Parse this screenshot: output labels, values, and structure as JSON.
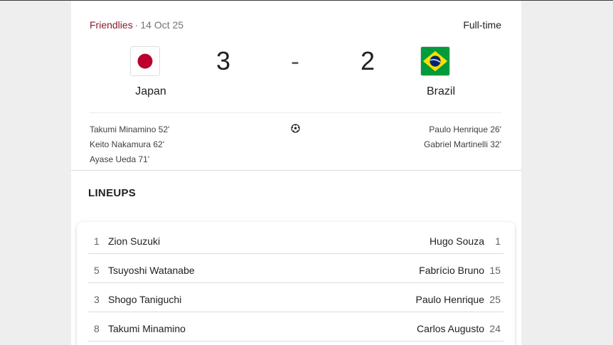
{
  "match": {
    "competition": "Friendlies",
    "separator": "·",
    "date": "14 Oct 25",
    "status": "Full-time",
    "home": {
      "name": "Japan",
      "score": "3",
      "flag_icon": "japan-flag-icon"
    },
    "away": {
      "name": "Brazil",
      "score": "2",
      "flag_icon": "brazil-flag-icon"
    },
    "dash": "-",
    "home_scorers": [
      "Takumi Minamino 52'",
      "Keito Nakamura 62'",
      "Ayase Ueda 71'"
    ],
    "away_scorers": [
      "Paulo Henrique 26'",
      "Gabriel Martinelli 32'"
    ]
  },
  "lineups": {
    "title": "LINEUPS",
    "rows": [
      {
        "home_num": "1",
        "home_name": "Zion Suzuki",
        "away_name": "Hugo Souza",
        "away_num": "1"
      },
      {
        "home_num": "5",
        "home_name": "Tsuyoshi Watanabe",
        "away_name": "Fabrício Bruno",
        "away_num": "15"
      },
      {
        "home_num": "3",
        "home_name": "Shogo Taniguchi",
        "away_name": "Paulo Henrique",
        "away_num": "25"
      },
      {
        "home_num": "8",
        "home_name": "Takumi Minamino",
        "away_name": "Carlos Augusto",
        "away_num": "24"
      }
    ]
  },
  "colors": {
    "competition": "#8b1a2b",
    "japan_red": "#bc002d",
    "brazil_green": "#009c3b",
    "brazil_yellow": "#ffdf00",
    "brazil_blue": "#002776"
  }
}
